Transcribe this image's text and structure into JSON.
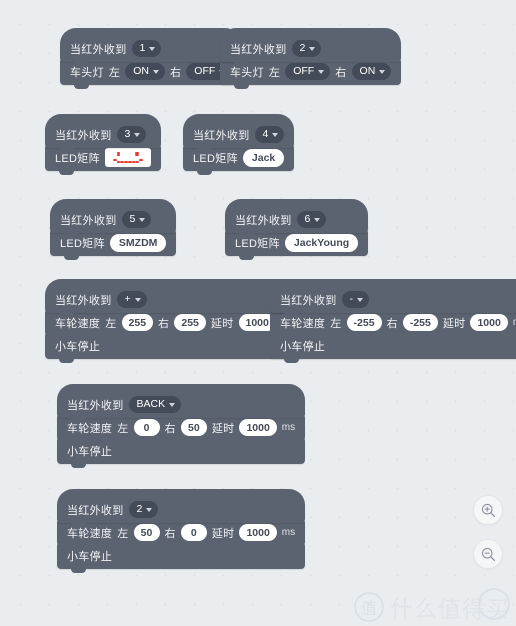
{
  "app": {
    "background_color": "#e9edf0",
    "block_color": "#5c6370",
    "field_color": "#434b59",
    "led_on_color": "#e8342c"
  },
  "labels": {
    "when_ir_received": "当红外收到",
    "headlight": "车头灯",
    "left": "左",
    "right": "右",
    "led_matrix": "LED矩阵",
    "wheel_speed": "车轮速度",
    "delay": "延时",
    "ms": "ms",
    "car_stop": "小车停止"
  },
  "scripts": [
    {
      "id": "script-1",
      "hat_value": "1",
      "body_type": "headlight",
      "left_value": "ON",
      "right_value": "OFF"
    },
    {
      "id": "script-2",
      "hat_value": "2",
      "body_type": "headlight",
      "left_value": "OFF",
      "right_value": "ON"
    },
    {
      "id": "script-3",
      "hat_value": "3",
      "body_type": "matrix_pattern",
      "pattern_name": "smiley-face"
    },
    {
      "id": "script-4",
      "hat_value": "4",
      "body_type": "matrix_text",
      "text_value": "Jack"
    },
    {
      "id": "script-5",
      "hat_value": "5",
      "body_type": "matrix_text",
      "text_value": "SMZDM"
    },
    {
      "id": "script-6",
      "hat_value": "6",
      "body_type": "matrix_text",
      "text_value": "JackYoung"
    },
    {
      "id": "script-7",
      "hat_value": "+",
      "body_type": "motion",
      "left_speed": "255",
      "right_speed": "255",
      "delay_value": "1000"
    },
    {
      "id": "script-8",
      "hat_value": "-",
      "body_type": "motion",
      "left_speed": "-255",
      "right_speed": "-255",
      "delay_value": "1000"
    },
    {
      "id": "script-9",
      "hat_value": "BACK",
      "body_type": "motion",
      "left_speed": "0",
      "right_speed": "50",
      "delay_value": "1000"
    },
    {
      "id": "script-10",
      "hat_value": "2",
      "body_type": "motion",
      "left_speed": "50",
      "right_speed": "0",
      "delay_value": "1000"
    }
  ],
  "controls": {
    "zoom_in": "zoom-in",
    "zoom_out": "zoom-out"
  },
  "watermark": {
    "mark": "值",
    "text": "什么值得买"
  }
}
